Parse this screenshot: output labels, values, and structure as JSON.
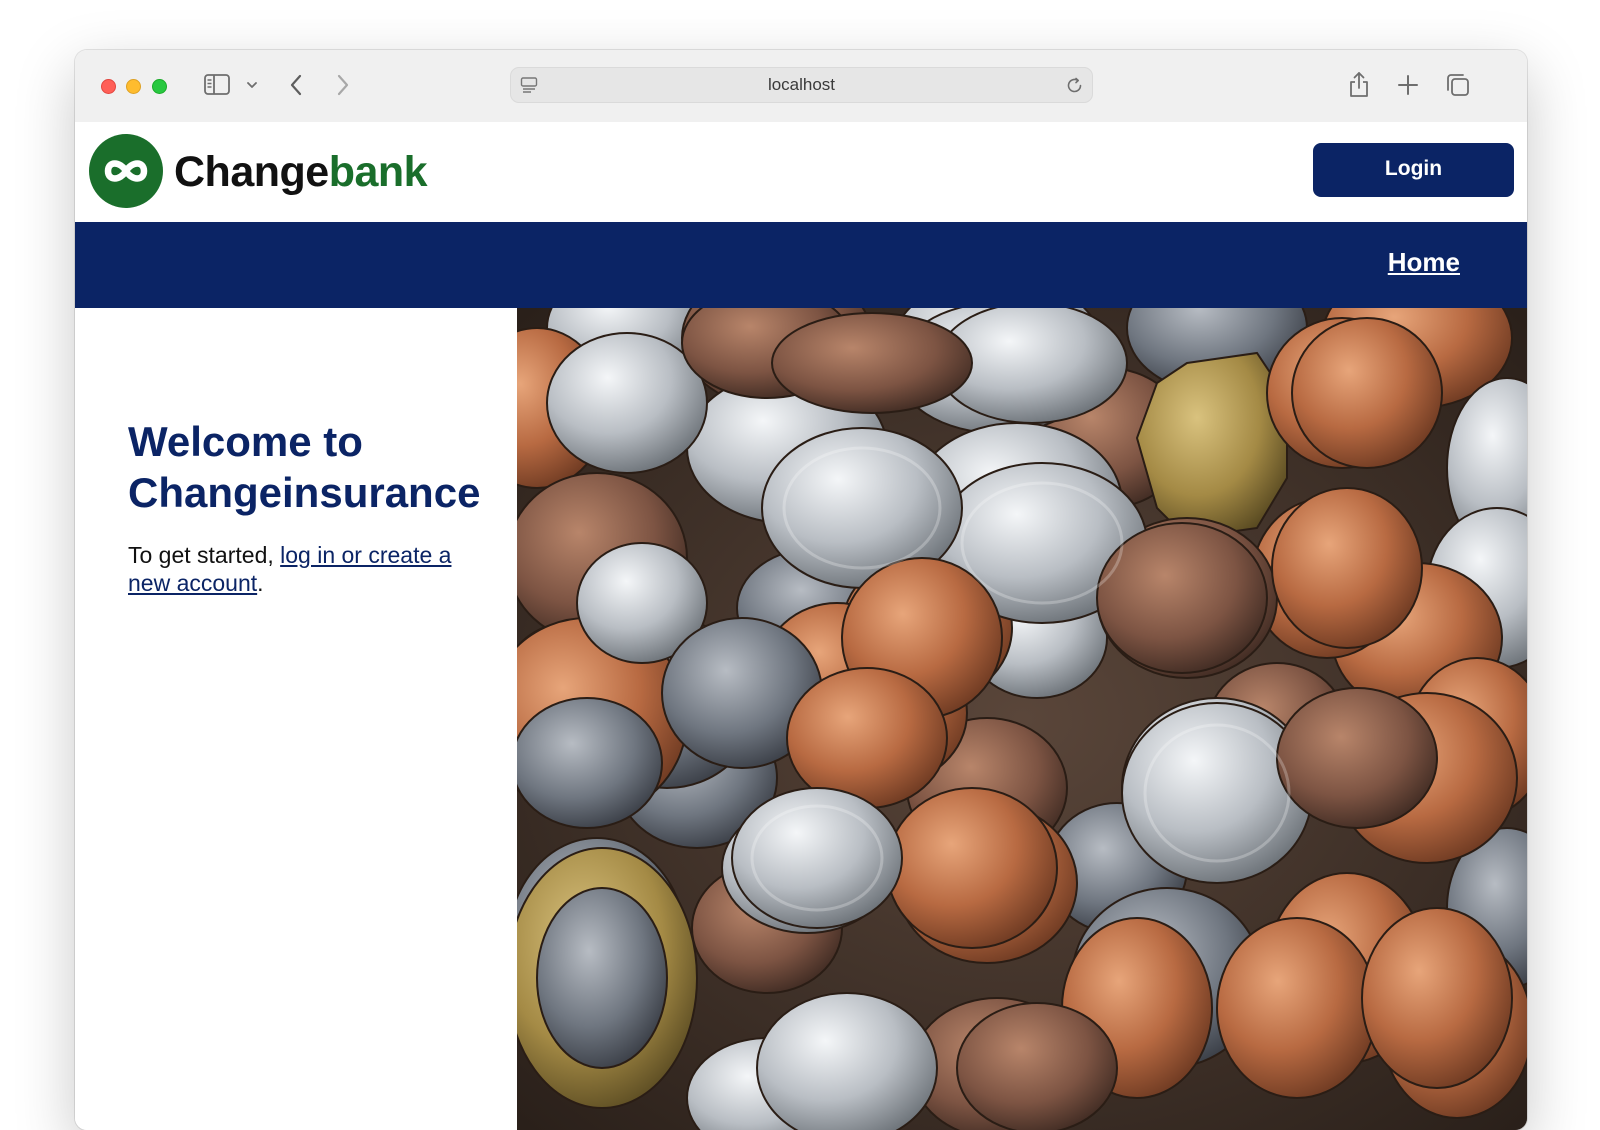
{
  "browser": {
    "url": "localhost",
    "controls": {
      "sidebar_icon": "sidebar-icon",
      "back_icon": "chevron-left-icon",
      "forward_icon": "chevron-right-icon",
      "share_icon": "share-icon",
      "new_tab_icon": "plus-icon",
      "tabs_icon": "tabs-overview-icon"
    }
  },
  "header": {
    "logo_part1": "Change",
    "logo_part2": "bank",
    "login_label": "Login"
  },
  "nav": {
    "home_label": "Home"
  },
  "main": {
    "title": "Welcome to Changeinsurance",
    "intro_prefix": "To get started, ",
    "intro_link": "log in or create a new account",
    "intro_suffix": "."
  },
  "colors": {
    "navy": "#0b2465",
    "brand_green": "#1a6e2b"
  }
}
